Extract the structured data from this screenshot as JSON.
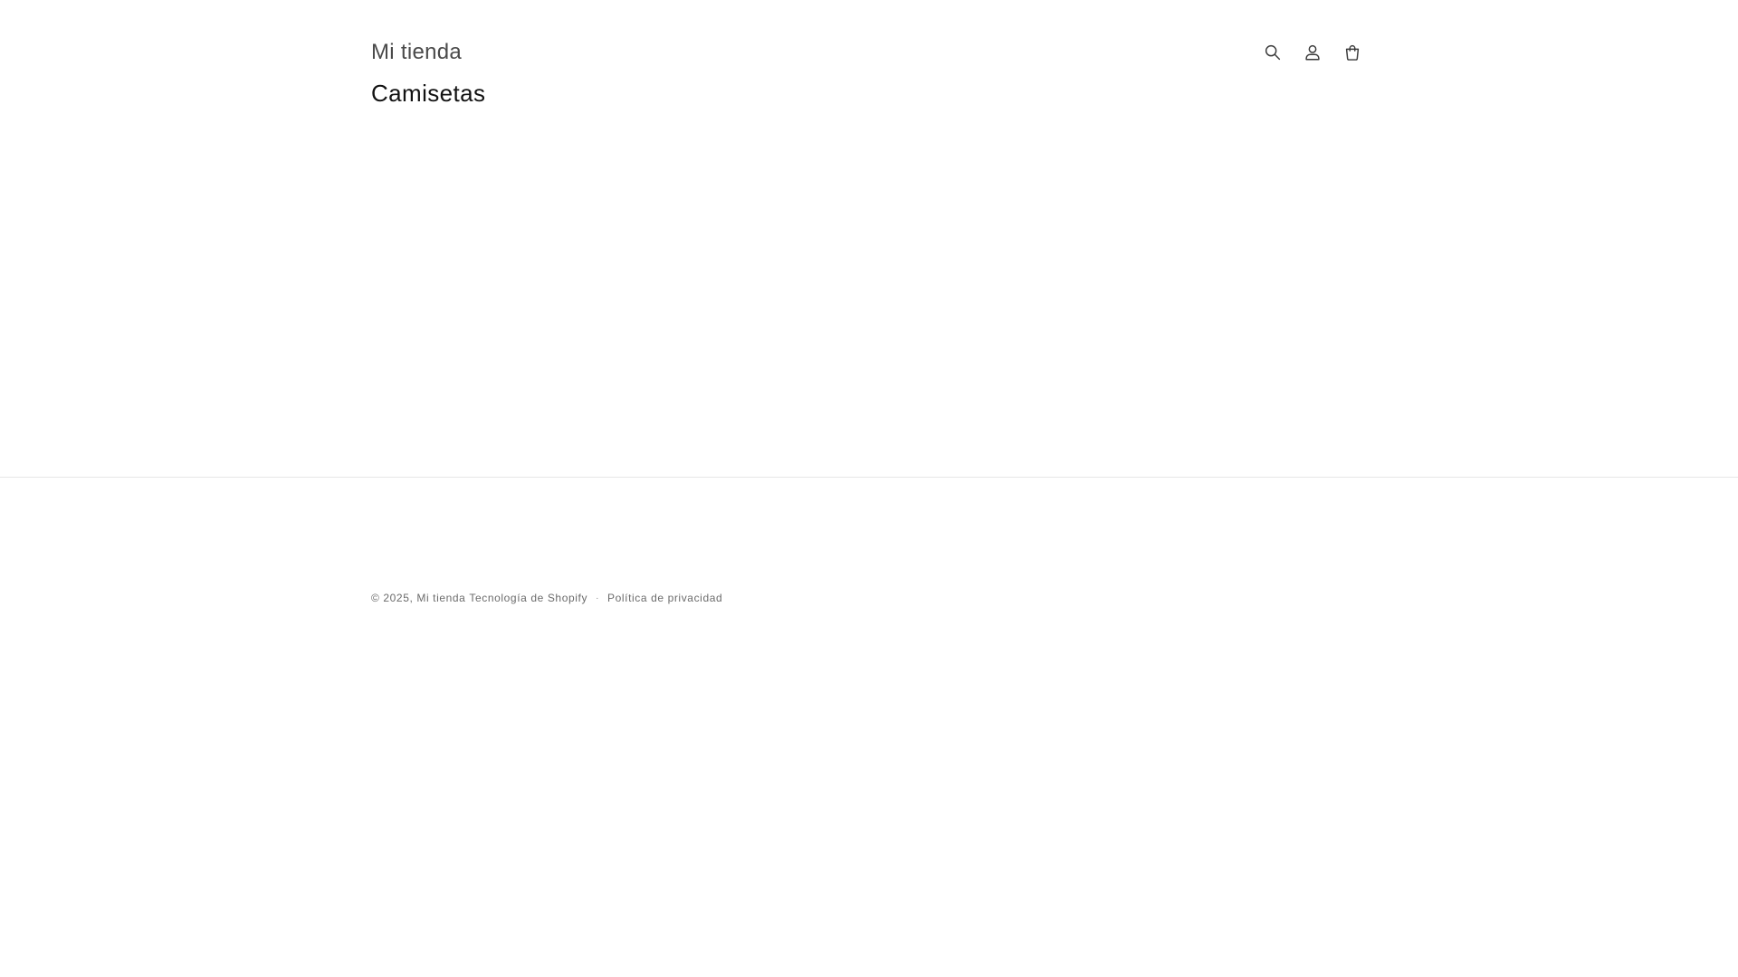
{
  "header": {
    "store_name": "Mi tienda",
    "icons": [
      "search-icon",
      "account-icon",
      "cart-icon"
    ]
  },
  "main": {
    "title": "Camisetas"
  },
  "footer": {
    "copyright_prefix": "© 2025,",
    "store_link": "Mi tienda",
    "powered_by": "Tecnología de Shopify",
    "separator": "·",
    "privacy_link": "Política de privacidad"
  },
  "colors": {
    "background": "#ffffff",
    "text_primary": "#121212",
    "text_muted": "#6b6b6b",
    "divider": "#e6e6e6"
  }
}
